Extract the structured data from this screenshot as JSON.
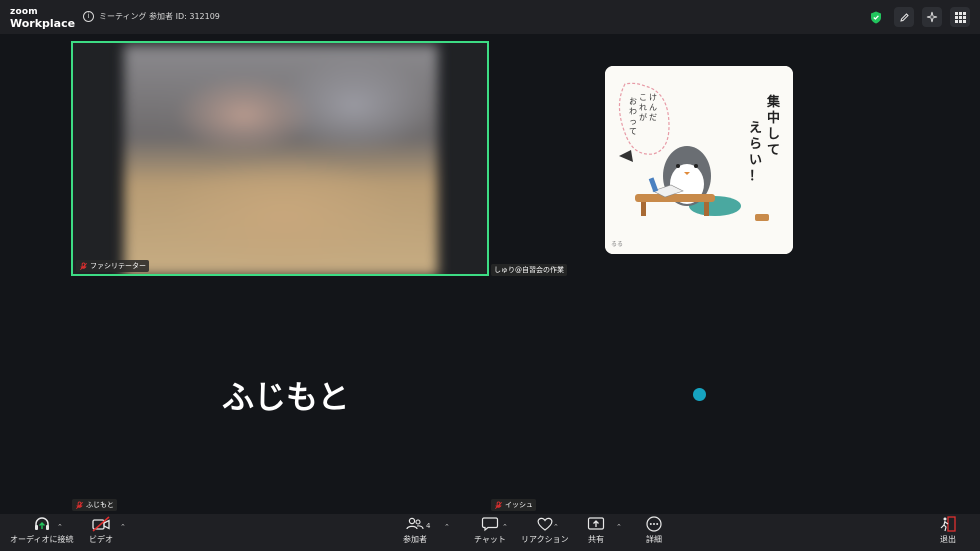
{
  "app": {
    "logo_top": "zoom",
    "logo_bottom": "Workplace"
  },
  "meeting": {
    "info": "ミーティング 参加者 ID: 312109"
  },
  "tiles": {
    "active_name": "ファシリテーター",
    "second_name": "しゅり@自習会の作業",
    "bottom_left_name": "ふじもと",
    "bottom_right_name": "イッシュ",
    "big_name": "ふじもと"
  },
  "toolbar": {
    "audio": "オーディオに接続",
    "video": "ビデオ",
    "participants": "参加者",
    "participant_count": "4",
    "chat": "チャット",
    "reactions": "リアクション",
    "share": "共有",
    "more": "詳細",
    "leave": "退出"
  },
  "colors": {
    "active_border": "#3ddc84",
    "leave": "#e02f2f",
    "dot": "#16a3c0",
    "mic_off": "#e02f2f"
  }
}
